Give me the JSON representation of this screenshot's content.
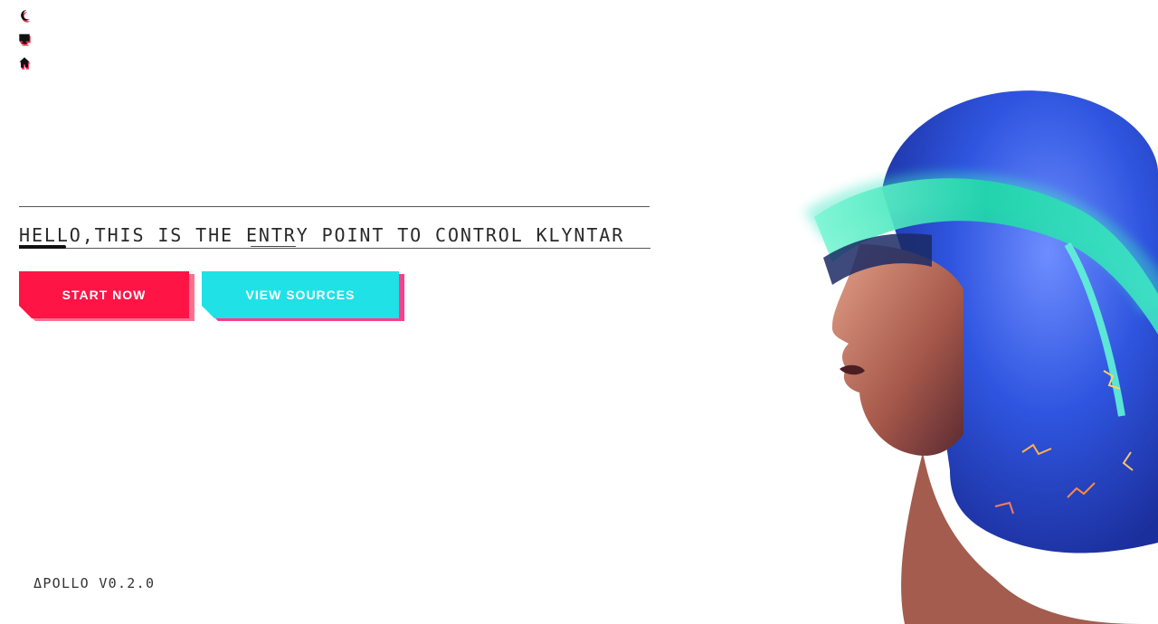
{
  "nav": {
    "icons": [
      {
        "name": "theme-toggle",
        "icon": "moon-icon"
      },
      {
        "name": "desktop",
        "icon": "monitor-icon"
      },
      {
        "name": "home",
        "icon": "home-icon"
      }
    ]
  },
  "hero": {
    "headline": "HELLO,THIS IS THE ENTRY POINT TO CONTROL KLYNTAR"
  },
  "actions": {
    "start_label": "START NOW",
    "sources_label": "VIEW SOURCES"
  },
  "footer": {
    "version": "ΔPOLLO V0.2.0"
  },
  "colors": {
    "primary": "#ff1446",
    "secondary": "#1fe1e6",
    "accent_shadow": "#ff2d55",
    "text": "#2a2a2a"
  }
}
